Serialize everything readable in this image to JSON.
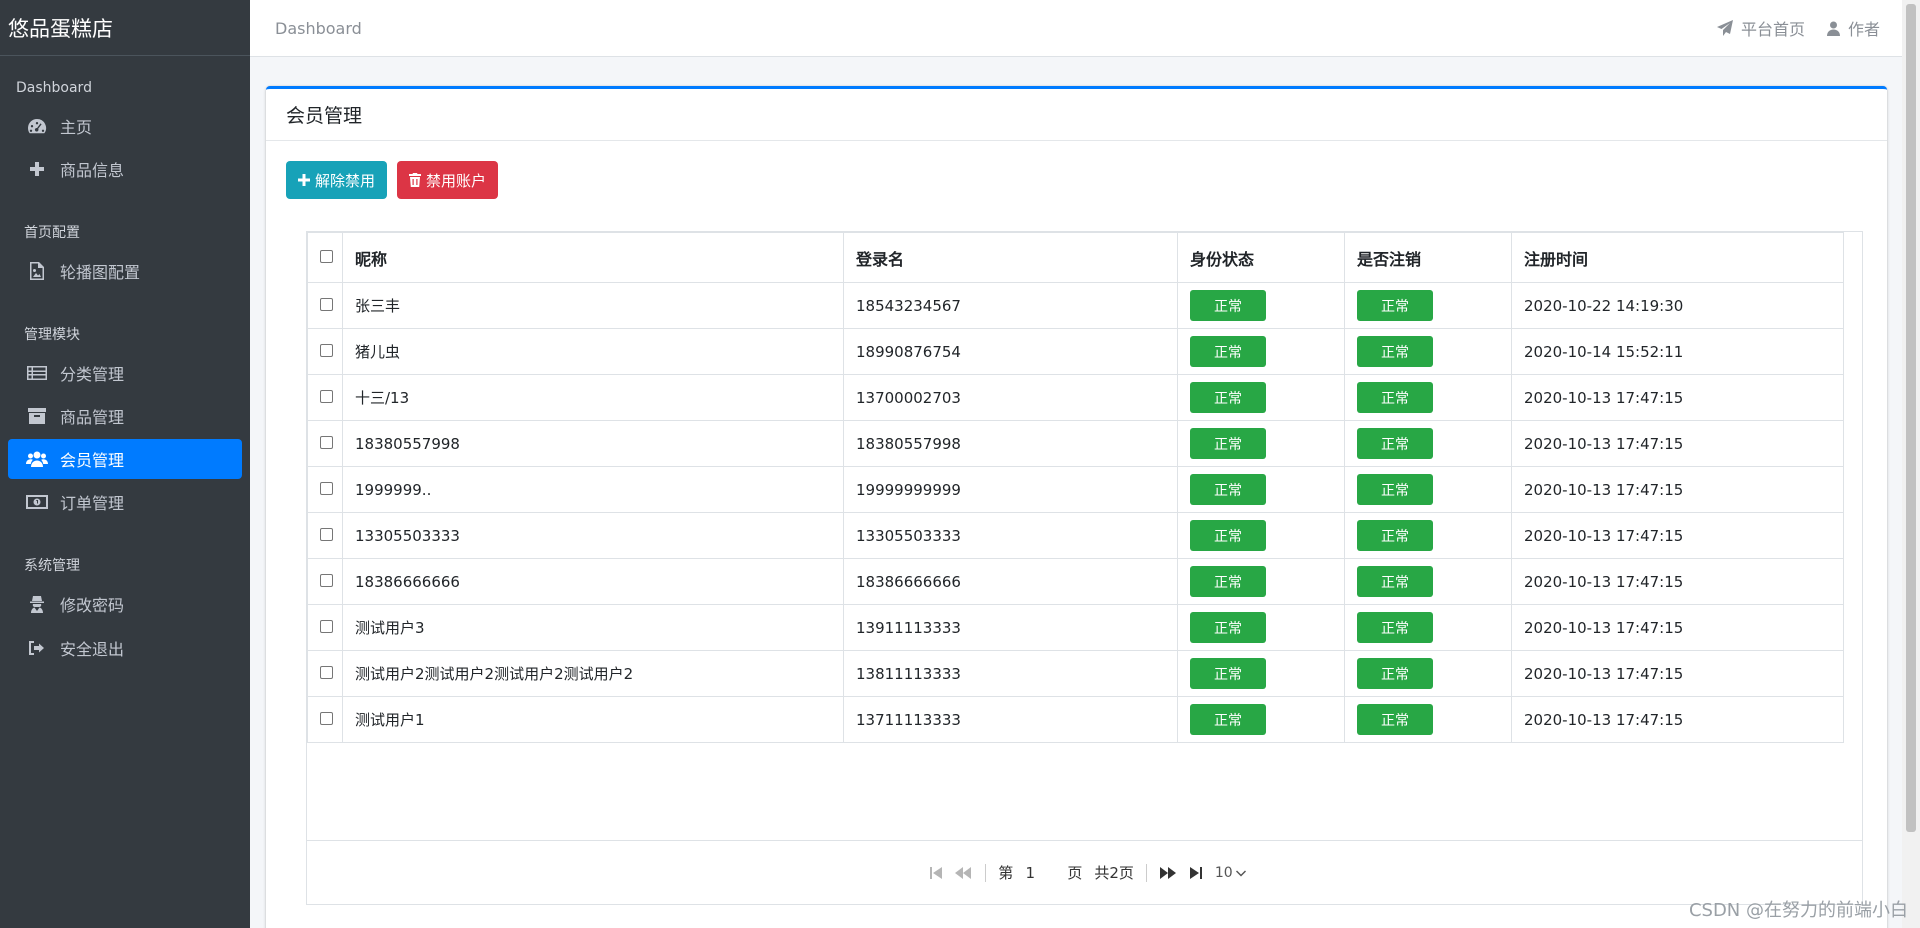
{
  "brand": "悠品蛋糕店",
  "topbar": {
    "breadcrumb": "Dashboard",
    "home_link": "平台首页",
    "author_link": "作者"
  },
  "sidebar": {
    "section1": "Dashboard",
    "item_home": "主页",
    "item_goods_info": "商品信息",
    "section2": "首页配置",
    "item_carousel": "轮播图配置",
    "section3": "管理模块",
    "item_category": "分类管理",
    "item_goods_mgmt": "商品管理",
    "item_member": "会员管理",
    "item_order": "订单管理",
    "section4": "系统管理",
    "item_password": "修改密码",
    "item_logout": "安全退出"
  },
  "card": {
    "title": "会员管理",
    "btn_unban": "解除禁用",
    "btn_ban": "禁用账户"
  },
  "table": {
    "headers": [
      "昵称",
      "登录名",
      "身份状态",
      "是否注销",
      "注册时间"
    ],
    "rows": [
      {
        "nickname": "张三丰",
        "login": "18543234567",
        "status": "正常",
        "deleted": "正常",
        "time": "2020-10-22 14:19:30"
      },
      {
        "nickname": "猪儿虫",
        "login": "18990876754",
        "status": "正常",
        "deleted": "正常",
        "time": "2020-10-14 15:52:11"
      },
      {
        "nickname": "十三/13",
        "login": "13700002703",
        "status": "正常",
        "deleted": "正常",
        "time": "2020-10-13 17:47:15"
      },
      {
        "nickname": "18380557998",
        "login": "18380557998",
        "status": "正常",
        "deleted": "正常",
        "time": "2020-10-13 17:47:15"
      },
      {
        "nickname": "1999999..",
        "login": "19999999999",
        "status": "正常",
        "deleted": "正常",
        "time": "2020-10-13 17:47:15"
      },
      {
        "nickname": "13305503333",
        "login": "13305503333",
        "status": "正常",
        "deleted": "正常",
        "time": "2020-10-13 17:47:15"
      },
      {
        "nickname": "18386666666",
        "login": "18386666666",
        "status": "正常",
        "deleted": "正常",
        "time": "2020-10-13 17:47:15"
      },
      {
        "nickname": "测试用户3",
        "login": "13911113333",
        "status": "正常",
        "deleted": "正常",
        "time": "2020-10-13 17:47:15"
      },
      {
        "nickname": "测试用户2测试用户2测试用户2测试用户2",
        "login": "13811113333",
        "status": "正常",
        "deleted": "正常",
        "time": "2020-10-13 17:47:15"
      },
      {
        "nickname": "测试用户1",
        "login": "13711113333",
        "status": "正常",
        "deleted": "正常",
        "time": "2020-10-13 17:47:15"
      }
    ]
  },
  "pager": {
    "page_prefix": "第",
    "current_page": "1",
    "page_suffix": "页",
    "total": "共2页",
    "page_size": "10"
  },
  "watermark": "CSDN @在努力的前端小白"
}
